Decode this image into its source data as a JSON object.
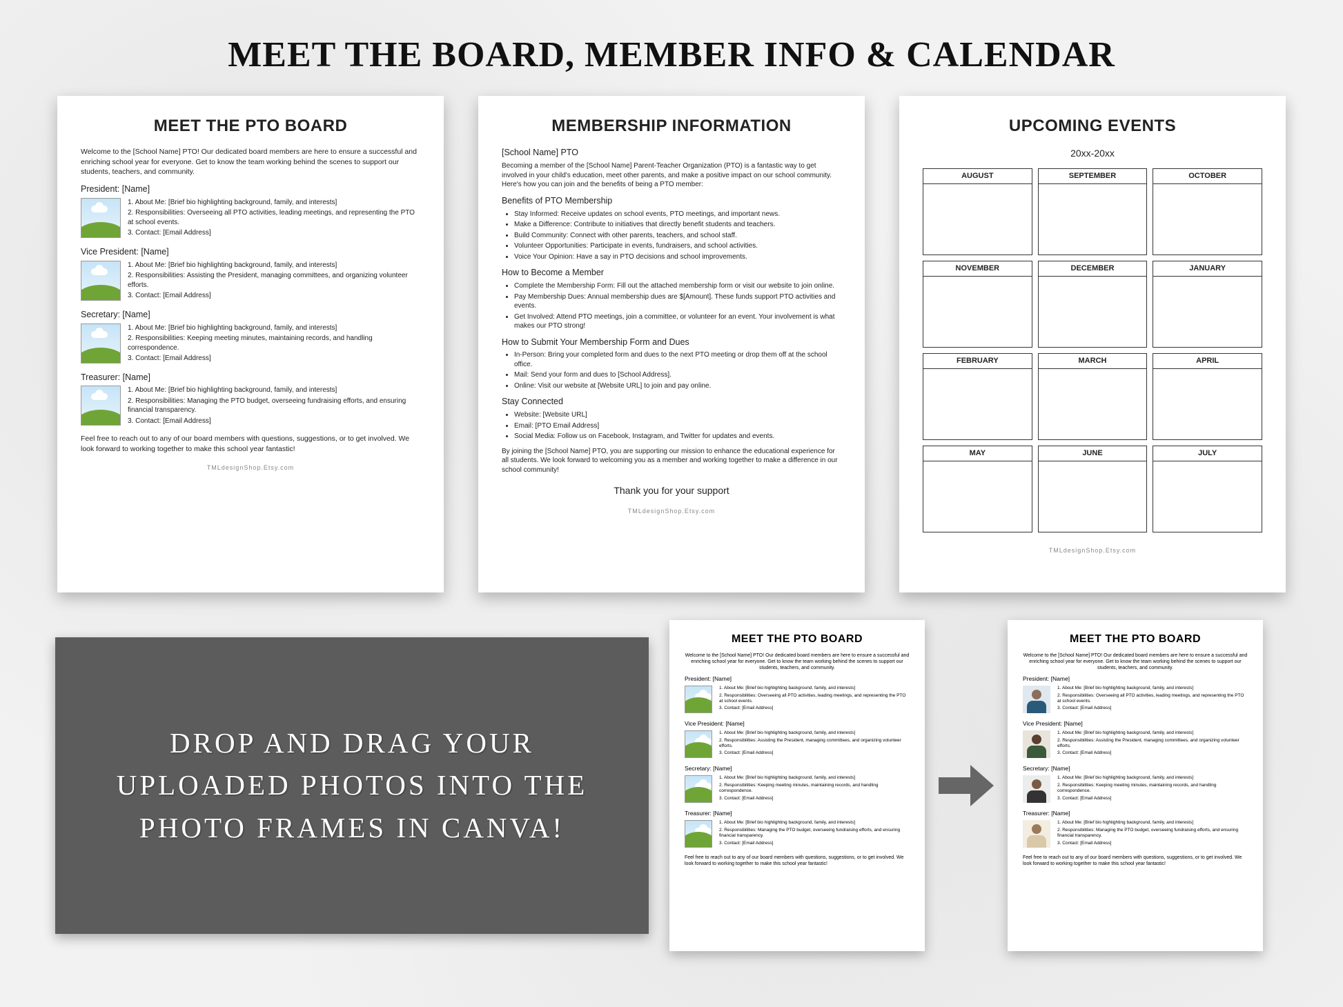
{
  "main_title": "MEET THE BOARD, MEMBER INFO & CALENDAR",
  "gray_box_text": "DROP AND DRAG YOUR UPLOADED PHOTOS INTO THE PHOTO FRAMES IN CANVA!",
  "footer_url": "TMLdesignShop.Etsy.com",
  "board": {
    "title": "MEET THE PTO BOARD",
    "intro": "Welcome to the [School Name] PTO! Our dedicated board members are here to ensure a successful and enriching school year for everyone. Get to know the team working behind the scenes to support our students, teachers, and community.",
    "closing": "Feel free to reach out to any of our board members with questions, suggestions, or to get involved. We look forward to working together to make this school year fantastic!",
    "members": [
      {
        "role": "President: [Name]",
        "l1": "1. About Me: [Brief bio highlighting background, family, and interests]",
        "l2": "2. Responsibilities: Overseeing all PTO activities, leading meetings, and representing the PTO at school events.",
        "l3": "3. Contact: [Email Address]"
      },
      {
        "role": "Vice President: [Name]",
        "l1": "1. About Me: [Brief bio highlighting background, family, and interests]",
        "l2": "2. Responsibilities: Assisting the President, managing committees, and organizing volunteer efforts.",
        "l3": "3. Contact: [Email Address]"
      },
      {
        "role": "Secretary: [Name]",
        "l1": "1. About Me: [Brief bio highlighting background, family, and interests]",
        "l2": "2. Responsibilities: Keeping meeting minutes, maintaining records, and handling correspondence.",
        "l3": "3. Contact: [Email Address]"
      },
      {
        "role": "Treasurer: [Name]",
        "l1": "1. About Me: [Brief bio highlighting background, family, and interests]",
        "l2": "2. Responsibilities: Managing the PTO budget, overseeing fundraising efforts, and ensuring financial transparency.",
        "l3": "3. Contact: [Email Address]"
      }
    ]
  },
  "membership": {
    "title": "MEMBERSHIP INFORMATION",
    "school": "[School Name] PTO",
    "intro": "Becoming a member of the [School Name] Parent-Teacher Organization (PTO) is a fantastic way to get involved in your child's education, meet other parents, and make a positive impact on our school community. Here's how you can join and the benefits of being a PTO member:",
    "h_benefits": "Benefits of PTO Membership",
    "benefits": [
      "Stay Informed: Receive updates on school events, PTO meetings, and important news.",
      "Make a Difference: Contribute to initiatives that directly benefit students and teachers.",
      "Build Community: Connect with other parents, teachers, and school staff.",
      "Volunteer Opportunities: Participate in events, fundraisers, and school activities.",
      "Voice Your Opinion: Have a say in PTO decisions and school improvements."
    ],
    "h_become": "How to Become a Member",
    "become": [
      "Complete the Membership Form: Fill out the attached membership form or visit our website to join online.",
      "Pay Membership Dues: Annual membership dues are $[Amount]. These funds support PTO activities and events.",
      "Get Involved: Attend PTO meetings, join a committee, or volunteer for an event. Your involvement is what makes our PTO strong!"
    ],
    "h_submit": "How to Submit Your Membership Form and Dues",
    "submit": [
      "In-Person: Bring your completed form and dues to the next PTO meeting or drop them off at the school office.",
      "Mail: Send your form and dues to [School Address].",
      "Online: Visit our website at [Website URL] to join and pay online."
    ],
    "h_stay": "Stay Connected",
    "stay": [
      "Website: [Website URL]",
      "Email: [PTO Email Address]",
      "Social Media: Follow us on Facebook, Instagram, and Twitter for updates and events."
    ],
    "closing": "By joining the [School Name] PTO, you are supporting our mission to enhance the educational experience for all students. We look forward to welcoming you as a member and working together to make a difference in our school community!",
    "thanks": "Thank you for your support"
  },
  "calendar": {
    "title": "UPCOMING EVENTS",
    "sub": "20xx-20xx",
    "months": [
      "AUGUST",
      "SEPTEMBER",
      "OCTOBER",
      "NOVEMBER",
      "DECEMBER",
      "JANUARY",
      "FEBRUARY",
      "MARCH",
      "APRIL",
      "MAY",
      "JUNE",
      "JULY"
    ]
  }
}
